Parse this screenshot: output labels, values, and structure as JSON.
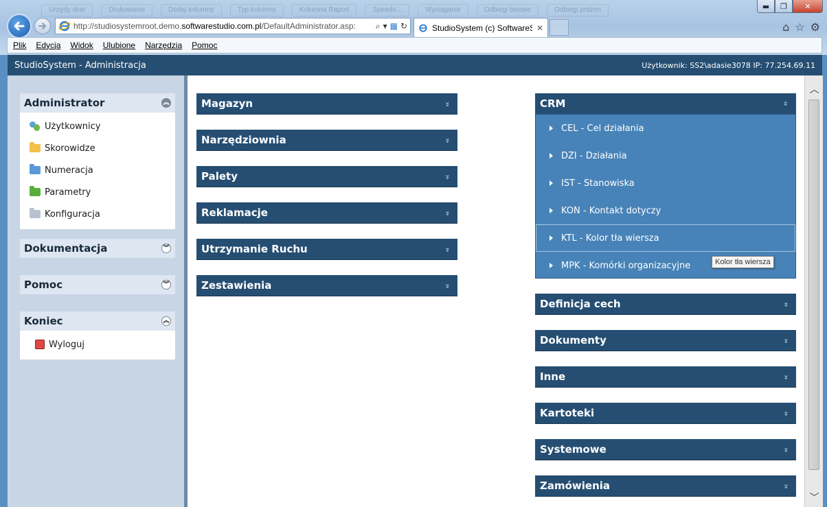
{
  "browser": {
    "faded_tabs": [
      "Urzędy skar",
      "Drukowanie",
      "Dodaj kolumnę",
      "Typ kolumny",
      "Kolumna Raport",
      "Speedo...",
      "Wyciąganie",
      "Odbiegi bisowe",
      "Odbiegi prdzen"
    ],
    "window_buttons": {
      "minimize": "▬",
      "maximize": "❐",
      "close": "✕"
    },
    "address": {
      "url_prefix": "http://studiosystemroot.demo.",
      "url_domain": "softwarestudio.com.pl",
      "url_suffix": "/DefaultAdministrator.asp:",
      "search_glyph": "⌕",
      "dropdown_glyph": "▾",
      "refresh_glyph": "↻"
    },
    "tab": {
      "title": "StudioSystem (c) SoftwareS...",
      "close": "✕"
    },
    "icons": {
      "home": "⌂",
      "favorites": "☆",
      "tools": "⚙"
    },
    "menu": [
      "Plik",
      "Edycja",
      "Widok",
      "Ulubione",
      "Narzędzia",
      "Pomoc"
    ]
  },
  "app": {
    "title": "StudioSystem - Administracja",
    "user_info": "Użytkownik: SS2\\adasie3078 IP: 77.254.69.11"
  },
  "sidebar": {
    "administrator": {
      "title": "Administrator",
      "items": [
        {
          "label": "Użytkownicy",
          "icon": "users-icon"
        },
        {
          "label": "Skorowidze",
          "icon": "folder-icon",
          "color": "#f2c04c"
        },
        {
          "label": "Numeracja",
          "icon": "folder-icon",
          "color": "#5a9ad8"
        },
        {
          "label": "Parametry",
          "icon": "folder-icon",
          "color": "#58b03c"
        },
        {
          "label": "Konfiguracja",
          "icon": "folder-icon",
          "color": "#b9c3cf"
        }
      ]
    },
    "dokumentacja": {
      "title": "Dokumentacja"
    },
    "pomoc": {
      "title": "Pomoc"
    },
    "koniec": {
      "title": "Koniec",
      "items": [
        {
          "label": "Wyloguj",
          "icon": "logout-icon"
        }
      ]
    }
  },
  "modules_left": [
    "Magazyn",
    "Narzędziownia",
    "Palety",
    "Reklamacje",
    "Utrzymanie Ruchu",
    "Zestawienia"
  ],
  "crm": {
    "title": "CRM",
    "items": [
      "CEL - Cel działania",
      "DZI - Działania",
      "IST - Stanowiska",
      "KON - Kontakt dotyczy",
      "KTL - Kolor tła wiersza",
      "MPK - Komórki organizacyjne"
    ]
  },
  "modules_right": [
    "Definicja cech",
    "Dokumenty",
    "Inne",
    "Kartoteki",
    "Systemowe",
    "Zamówienia"
  ],
  "tooltip": "Kolor tła wiersza",
  "colors": {
    "header": "#254e72",
    "crm_body": "#4783b8",
    "sidebar_bg": "#c7d5e5"
  }
}
